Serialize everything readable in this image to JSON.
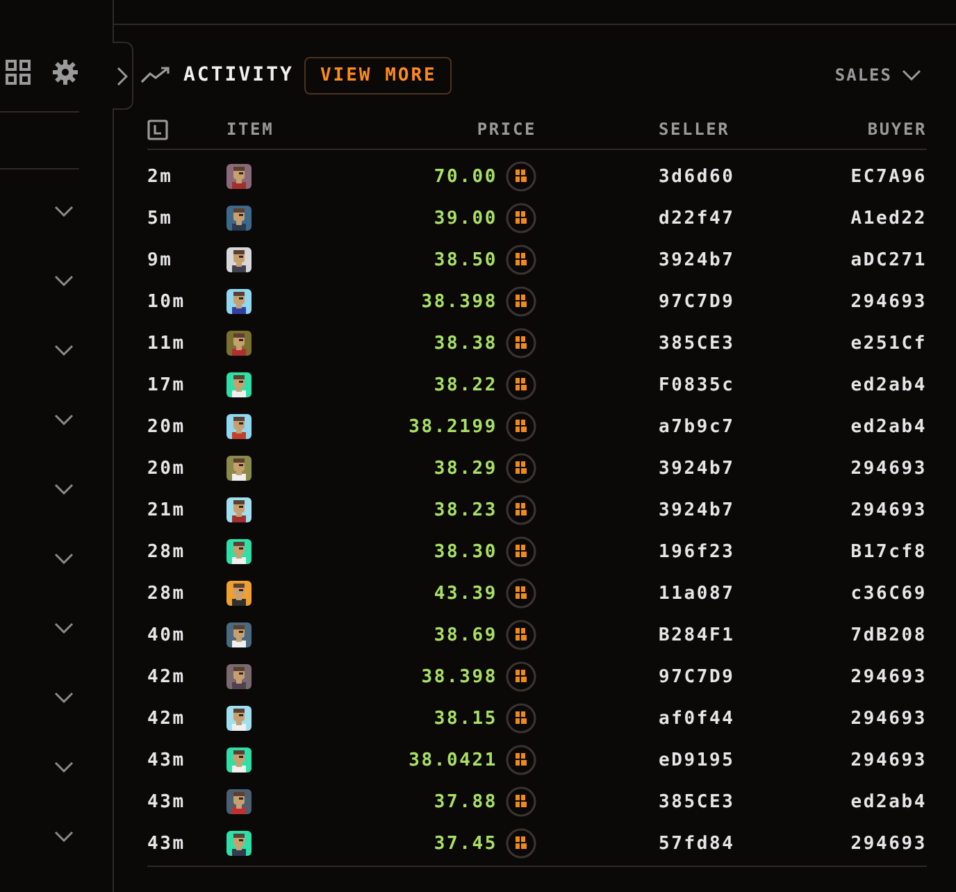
{
  "sidebar": {
    "sections": [
      {
        "expanded": false
      },
      {
        "expanded": false
      },
      {
        "expanded": false
      },
      {
        "expanded": false
      },
      {
        "expanded": false
      },
      {
        "expanded": false
      },
      {
        "expanded": false
      },
      {
        "expanded": false
      },
      {
        "expanded": false
      },
      {
        "expanded": false
      }
    ]
  },
  "activity": {
    "title": "ACTIVITY",
    "view_more": "VIEW MORE",
    "filter": "SALES",
    "columns": [
      "ITEM",
      "PRICE",
      "SELLER",
      "BUYER"
    ],
    "rows": [
      {
        "time": "2m",
        "price": "70.00",
        "seller": "3d6d60",
        "buyer": "EC7A96"
      },
      {
        "time": "5m",
        "price": "39.00",
        "seller": "d22f47",
        "buyer": "A1ed22"
      },
      {
        "time": "9m",
        "price": "38.50",
        "seller": "3924b7",
        "buyer": "aDC271"
      },
      {
        "time": "10m",
        "price": "38.398",
        "seller": "97C7D9",
        "buyer": "294693"
      },
      {
        "time": "11m",
        "price": "38.38",
        "seller": "385CE3",
        "buyer": "e251Cf"
      },
      {
        "time": "17m",
        "price": "38.22",
        "seller": "F0835c",
        "buyer": "ed2ab4"
      },
      {
        "time": "20m",
        "price": "38.2199",
        "seller": "a7b9c7",
        "buyer": "ed2ab4"
      },
      {
        "time": "20m",
        "price": "38.29",
        "seller": "3924b7",
        "buyer": "294693"
      },
      {
        "time": "21m",
        "price": "38.23",
        "seller": "3924b7",
        "buyer": "294693"
      },
      {
        "time": "28m",
        "price": "38.30",
        "seller": "196f23",
        "buyer": "B17cf8"
      },
      {
        "time": "28m",
        "price": "43.39",
        "seller": "11a087",
        "buyer": "c36C69"
      },
      {
        "time": "40m",
        "price": "38.69",
        "seller": "B284F1",
        "buyer": "7dB208"
      },
      {
        "time": "42m",
        "price": "38.398",
        "seller": "97C7D9",
        "buyer": "294693"
      },
      {
        "time": "42m",
        "price": "38.15",
        "seller": "af0f44",
        "buyer": "294693"
      },
      {
        "time": "43m",
        "price": "38.0421",
        "seller": "eD9195",
        "buyer": "294693"
      },
      {
        "time": "43m",
        "price": "37.88",
        "seller": "385CE3",
        "buyer": "ed2ab4"
      },
      {
        "time": "43m",
        "price": "37.45",
        "seller": "57fd84",
        "buyer": "294693"
      }
    ]
  }
}
